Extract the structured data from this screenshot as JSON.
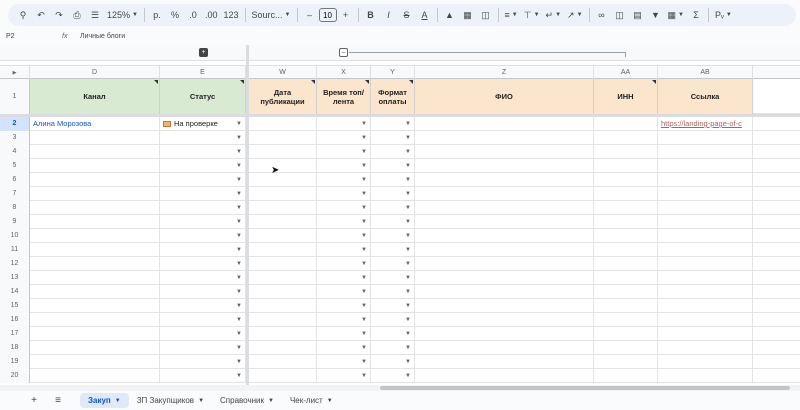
{
  "toolbar": {
    "zoom": "125%",
    "currency": "р.",
    "percent": "%",
    "dec_decrease": ".0",
    "dec_increase": ".00",
    "number_format": "123",
    "font": "Sourc...",
    "font_size": "10"
  },
  "formula_bar": {
    "cell_ref": "P2",
    "fx": "fx",
    "content": "Личные блоги"
  },
  "columns": [
    "D",
    "E",
    "W",
    "X",
    "Y",
    "Z",
    "AA",
    "AB"
  ],
  "header": {
    "row_num": "1",
    "kanal": "Канал",
    "status": "Статус",
    "data_pub": "Дата публикации",
    "vremya": "Время топ/лента",
    "format": "Формат оплаты",
    "fio": "ФИО",
    "inn": "ИНН",
    "link": "Ссылка"
  },
  "row2": {
    "num": "2",
    "kanal": "Алина Морозова",
    "status": "На проверке",
    "link": "https://landing-page-of-c"
  },
  "row_numbers": [
    "3",
    "4",
    "5",
    "6",
    "7",
    "8",
    "9",
    "10",
    "11",
    "12",
    "13",
    "14",
    "15",
    "16",
    "17",
    "18",
    "19",
    "20"
  ],
  "sheet_tabs": [
    "Закуп",
    "ЗП Закупщиков",
    "Справочник",
    "Чек-лист"
  ],
  "colors": {
    "header_green": "#d9ead3",
    "header_orange": "#fce5cd",
    "active_blue": "#0b57d0"
  }
}
